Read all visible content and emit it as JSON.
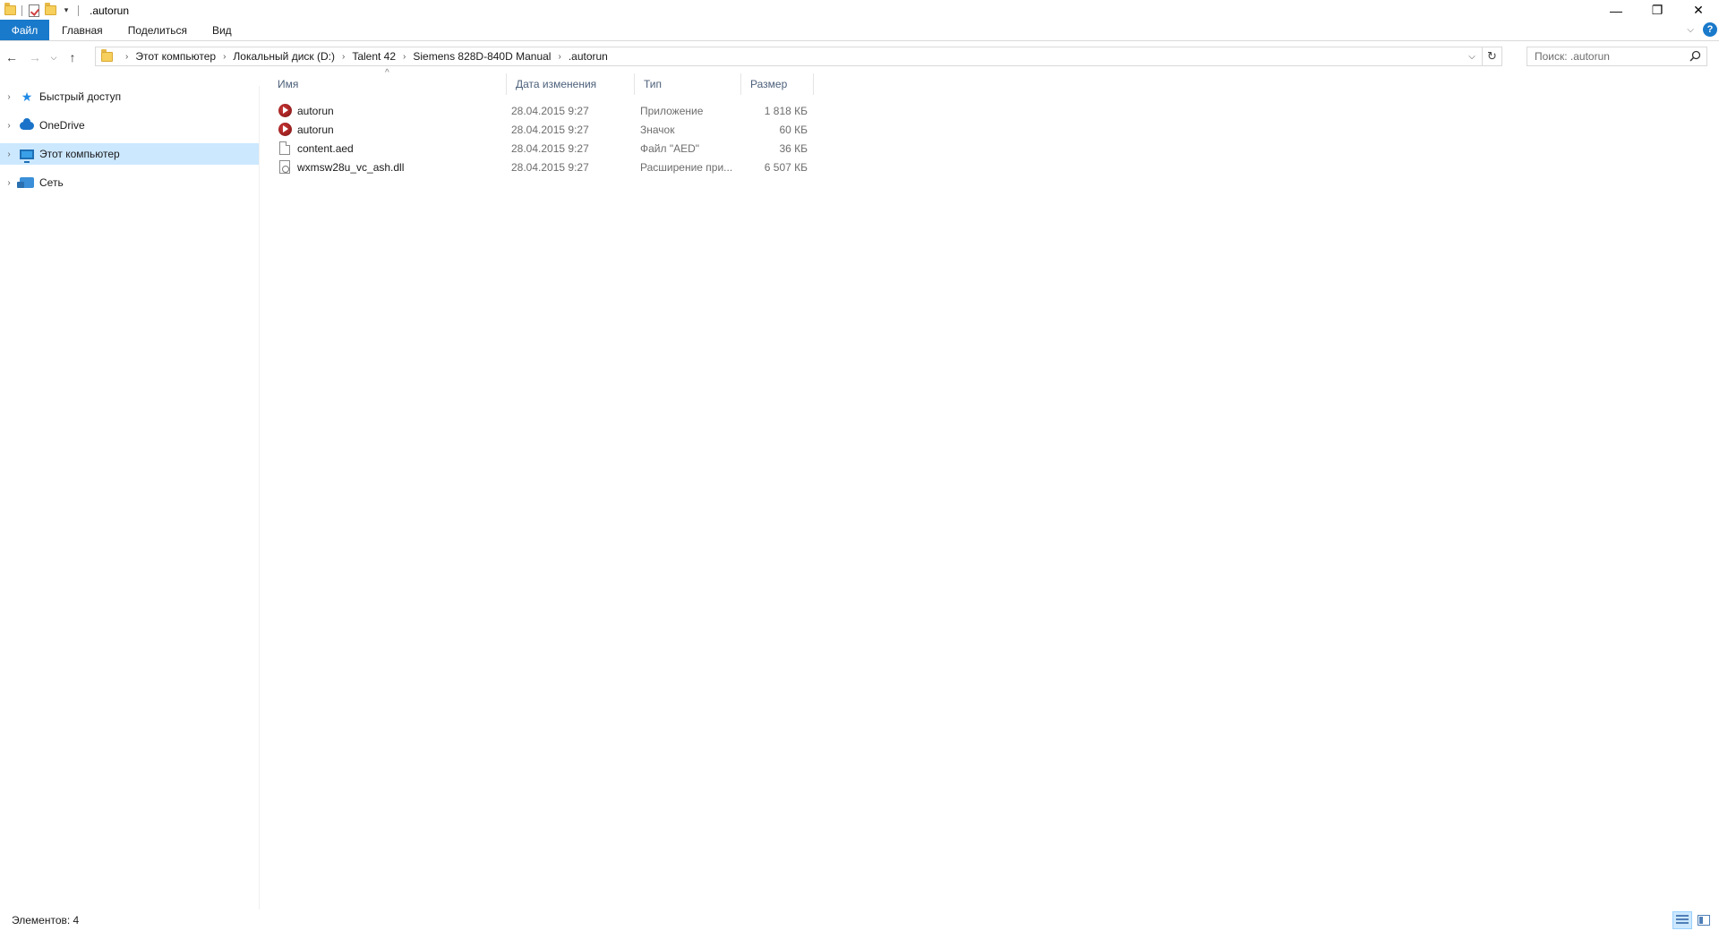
{
  "window": {
    "title": ".autorun",
    "controls": {
      "minimize": "—",
      "maximize": "❐",
      "close": "✕"
    }
  },
  "ribbon": {
    "tabs": [
      {
        "label": "Файл"
      },
      {
        "label": "Главная"
      },
      {
        "label": "Поделиться"
      },
      {
        "label": "Вид"
      }
    ],
    "help": "?"
  },
  "address": {
    "breadcrumbs": [
      "Этот компьютер",
      "Локальный диск (D:)",
      "Talent 42",
      "Siemens 828D-840D Manual",
      ".autorun"
    ]
  },
  "search": {
    "placeholder": "Поиск: .autorun"
  },
  "navpane": {
    "items": [
      {
        "label": "Быстрый доступ",
        "icon": "star-icon"
      },
      {
        "label": "OneDrive",
        "icon": "cloud-icon"
      },
      {
        "label": "Этот компьютер",
        "icon": "computer-icon",
        "selected": true
      },
      {
        "label": "Сеть",
        "icon": "network-icon"
      }
    ]
  },
  "filelist": {
    "columns": {
      "name": "Имя",
      "date": "Дата изменения",
      "type": "Тип",
      "size": "Размер"
    },
    "rows": [
      {
        "name": "autorun",
        "date": "28.04.2015 9:27",
        "type": "Приложение",
        "size": "1 818 КБ",
        "icon": "application-icon"
      },
      {
        "name": "autorun",
        "date": "28.04.2015 9:27",
        "type": "Значок",
        "size": "60 КБ",
        "icon": "application-icon"
      },
      {
        "name": "content.aed",
        "date": "28.04.2015 9:27",
        "type": "Файл \"AED\"",
        "size": "36 КБ",
        "icon": "document-icon"
      },
      {
        "name": "wxmsw28u_vc_ash.dll",
        "date": "28.04.2015 9:27",
        "type": "Расширение при...",
        "size": "6 507 КБ",
        "icon": "dll-icon"
      }
    ]
  },
  "status": {
    "text": "Элементов: 4"
  },
  "colors": {
    "accent": "#1979ca",
    "selection": "#cce8ff"
  }
}
